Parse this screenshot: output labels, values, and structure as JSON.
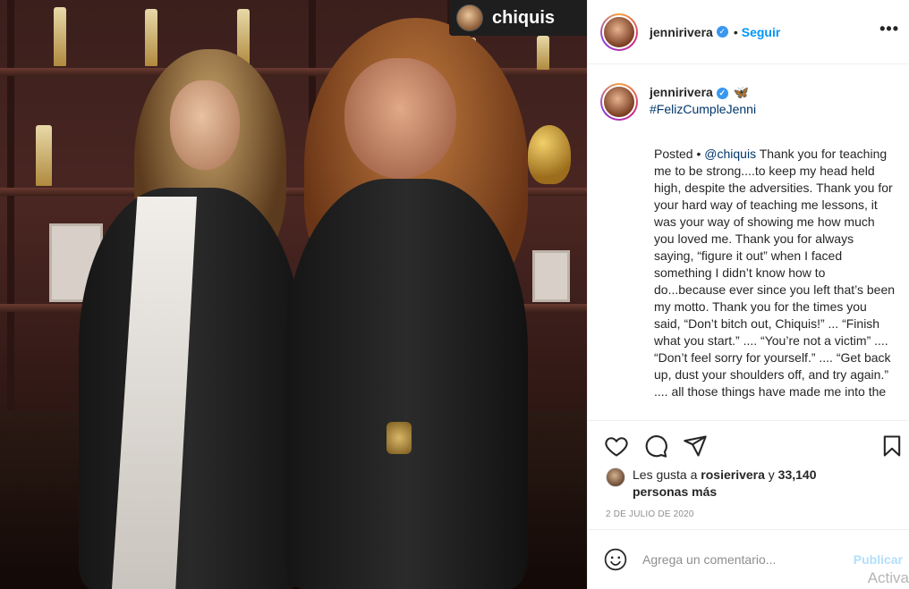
{
  "photo": {
    "badge_username": "chiquis"
  },
  "post_header": {
    "username": "jennirivera",
    "verified": true,
    "separator": "•",
    "follow_label": "Seguir",
    "more_label": "•••"
  },
  "caption": {
    "username": "jennirivera",
    "emoji": "🦋",
    "hashtag": "#FelizCumpleJenni",
    "prefix": "Posted • ",
    "mention": "@chiquis",
    "text": " Thank you for teaching me to be strong....to keep my head held high, despite the adversities. Thank you for your hard way of teaching me lessons, it was your way of showing me how much you loved me. Thank you for always saying, “figure it out” when I faced something I didn’t know how to do...because ever since you left that’s been my motto. Thank you for the times you said, “Don’t bitch out, Chiquis!” ... “Finish what you start.” .... “You’re not a victim” .... “Don’t feel sorry for yourself.” .... “Get back up, dust your shoulders off, and try again.” .... all those things have made me into the"
  },
  "actions": {
    "icons": [
      "heart-icon",
      "comment-icon",
      "share-icon",
      "bookmark-icon"
    ]
  },
  "likes": {
    "prefix": "Les gusta a ",
    "user": "rosierivera",
    "middle": " y ",
    "count": "33,140 personas más"
  },
  "date": "2 DE JULIO DE 2020",
  "comment": {
    "placeholder": "Agrega un comentario...",
    "publish_label": "Publicar"
  },
  "overlay": {
    "watermark": "Activa"
  },
  "colors": {
    "accent": "#0095f6",
    "verified": "#3897f0",
    "publish_disabled": "#b2dffc",
    "hashtag": "#00376b"
  }
}
